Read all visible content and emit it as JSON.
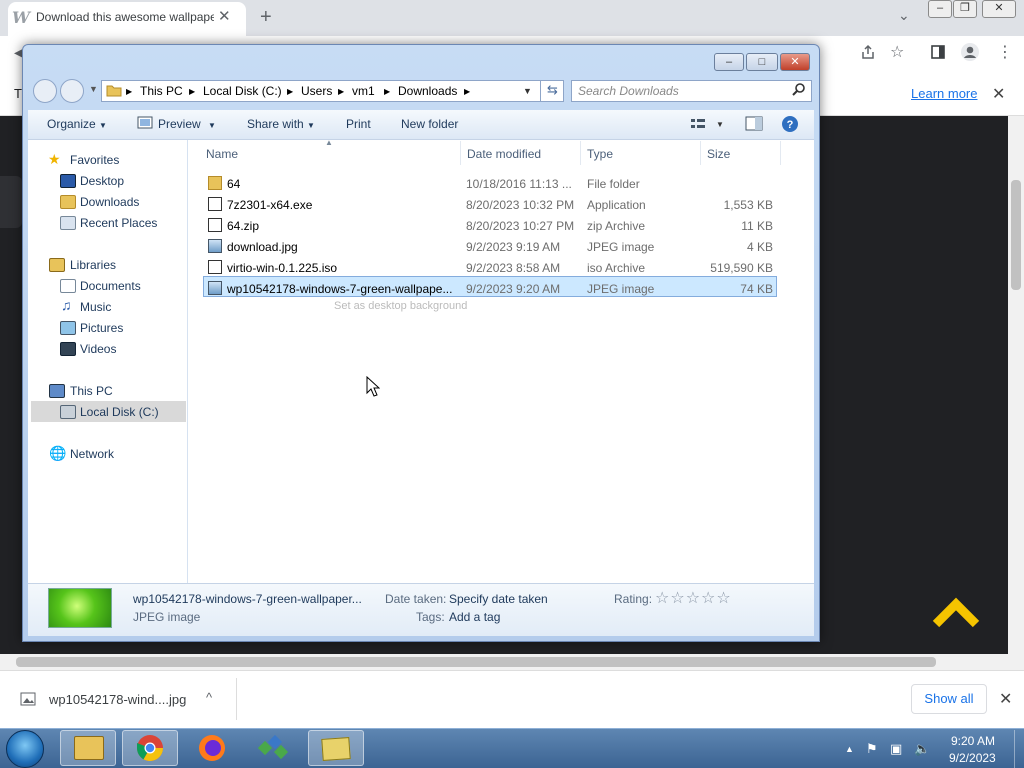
{
  "browser": {
    "tab_title": "Download this awesome wallpaper",
    "favicon_letter": "W",
    "close_glyph": "✕",
    "new_tab_glyph": "+",
    "tab_search_glyph": "⌄",
    "win_minimize": "–",
    "win_restore": "❐",
    "win_close": "✕",
    "infobar": {
      "learn_more": "Learn more",
      "close_glyph": "✕"
    },
    "infobar_left_char": "T"
  },
  "explorer": {
    "caption": {
      "minimize": "–",
      "maximize": "□",
      "close": "✕"
    },
    "breadcrumb": [
      "This PC",
      "Local Disk (C:)",
      "Users",
      "vm1",
      "Downloads"
    ],
    "search_placeholder": "Search Downloads",
    "toolbar": {
      "organize": "Organize",
      "preview": "Preview",
      "share_with": "Share with",
      "print": "Print",
      "new_folder": "New folder"
    },
    "nav": {
      "favorites": "Favorites",
      "desktop": "Desktop",
      "downloads": "Downloads",
      "recent": "Recent Places",
      "libraries": "Libraries",
      "documents": "Documents",
      "music": "Music",
      "pictures": "Pictures",
      "videos": "Videos",
      "thispc": "This PC",
      "localdisk": "Local Disk (C:)",
      "network": "Network"
    },
    "columns": {
      "name": "Name",
      "date": "Date modified",
      "type": "Type",
      "size": "Size"
    },
    "files": [
      {
        "name": "64",
        "date": "10/18/2016 11:13 ...",
        "type": "File folder",
        "size": "",
        "icon": "folder-icon"
      },
      {
        "name": "7z2301-x64.exe",
        "date": "8/20/2023 10:32 PM",
        "type": "Application",
        "size": "1,553 KB",
        "icon": "7zip-exe-icon"
      },
      {
        "name": "64.zip",
        "date": "8/20/2023 10:27 PM",
        "type": "zip Archive",
        "size": "11 KB",
        "icon": "zip-icon"
      },
      {
        "name": "download.jpg",
        "date": "9/2/2023 9:19 AM",
        "type": "JPEG image",
        "size": "4 KB",
        "icon": "image-file-icon"
      },
      {
        "name": "virtio-win-0.1.225.iso",
        "date": "9/2/2023 8:58 AM",
        "type": "iso Archive",
        "size": "519,590 KB",
        "icon": "iso-icon"
      },
      {
        "name": "wp10542178-windows-7-green-wallpape...",
        "date": "9/2/2023 9:20 AM",
        "type": "JPEG image",
        "size": "74 KB",
        "icon": "image-file-icon"
      }
    ],
    "tooltip": "Set as desktop background",
    "details": {
      "filename": "wp10542178-windows-7-green-wallpaper...",
      "filetype": "JPEG image",
      "date_taken_label": "Date taken:",
      "date_taken_value": "Specify date taken",
      "tags_label": "Tags:",
      "tags_value": "Add a tag",
      "rating_label": "Rating:",
      "rating_stars": "☆☆☆☆☆"
    }
  },
  "download_bar": {
    "filename": "wp10542178-wind....jpg",
    "show_all": "Show all",
    "caret": "^",
    "close_glyph": "✕"
  },
  "taskbar": {
    "time": "9:20 AM",
    "date": "9/2/2023"
  },
  "colors": {
    "accent": "#1a73e8",
    "selection": "#cce8ff",
    "scroll_top_arrow": "#f5c400"
  }
}
